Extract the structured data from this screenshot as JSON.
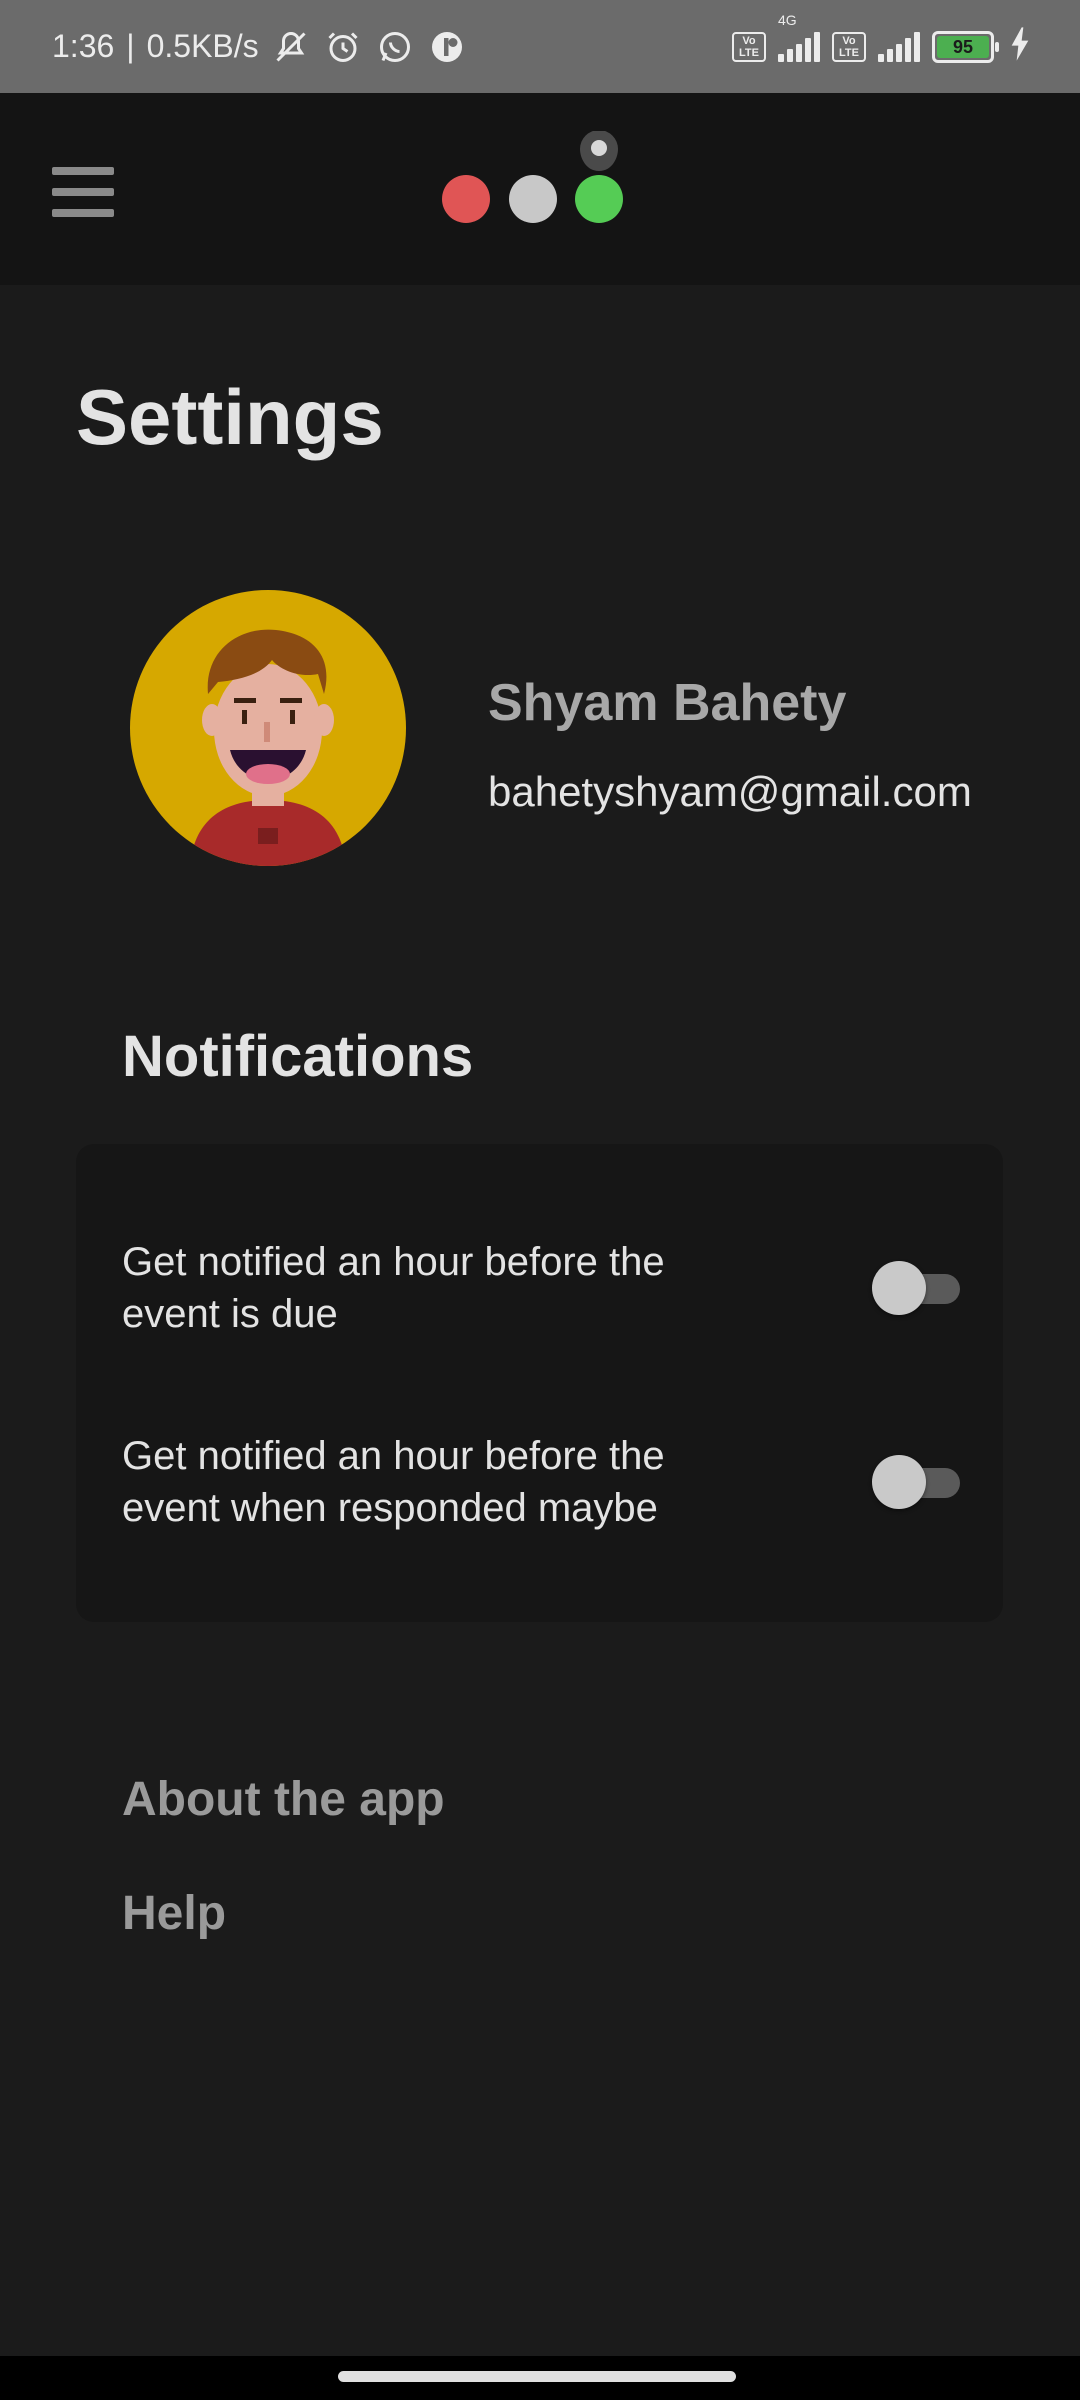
{
  "status_bar": {
    "time": "1:36",
    "separator": "|",
    "net_speed": "0.5KB/s",
    "sim1_badge": "Vo\nLTE",
    "sim1_network": "4G",
    "sim2_badge": "Vo\nLTE",
    "battery_level": "95",
    "icons": [
      "mute-icon",
      "alarm-icon",
      "whatsapp-icon",
      "app-notification-icon",
      "charging-icon"
    ]
  },
  "app_bar": {
    "logo_colors": [
      "#e05555",
      "#c8c8c8",
      "#55cc55"
    ]
  },
  "page": {
    "title": "Settings"
  },
  "profile": {
    "name": "Shyam Bahety",
    "email": "bahetyshyam@gmail.com"
  },
  "notifications": {
    "title": "Notifications",
    "items": [
      {
        "label": "Get notified an hour before the event is due",
        "enabled": false
      },
      {
        "label": "Get notified an hour before the event when responded maybe",
        "enabled": false
      }
    ]
  },
  "links": {
    "about": "About the app",
    "help": "Help"
  },
  "colors": {
    "background": "#1b1b1b",
    "app_bar": "#141414",
    "card": "#161616",
    "status_bar": "#6b6b6b",
    "battery": "#4caf50"
  }
}
